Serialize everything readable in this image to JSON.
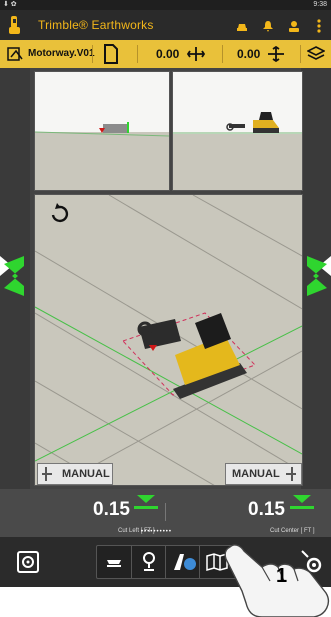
{
  "status_bar": {
    "time": "9:38"
  },
  "app": {
    "title": "Trimble® Earthworks"
  },
  "toolbar": {
    "design_name": "Motorway.V01",
    "value_1": "0.00",
    "value_2": "0.00"
  },
  "views": {
    "left_mode": "MANUAL",
    "right_mode": "MANUAL"
  },
  "values": {
    "left": {
      "value": "0.15",
      "caption": "Cut Left  [ FT ]"
    },
    "right": {
      "value": "0.15",
      "caption": "Cut Center  [ FT ]"
    },
    "page_dots": "••••••••••"
  },
  "annotation": {
    "step": "1"
  },
  "colors": {
    "accent": "#f3b71a",
    "toolbar": "#e9c13a",
    "guidance_green": "#2fd52f",
    "header": "#2a2a2a"
  },
  "icons": {
    "status_left": "notification-icons",
    "logo": "trimble-excavator-logo-icon",
    "appbar": [
      "machine-icon",
      "bell-icon",
      "operator-icon",
      "overflow-menu-icon"
    ],
    "toolbar": [
      "design-file-icon",
      "new-document-icon",
      "horizontal-offset-icon",
      "vertical-offset-icon",
      "layers-icon"
    ],
    "bottom": [
      "machine-settings-icon",
      "surface-guidance-icon",
      "locate-point-icon",
      "view-perspective-icon",
      "map-view-icon",
      "advanced-settings-icon"
    ]
  }
}
